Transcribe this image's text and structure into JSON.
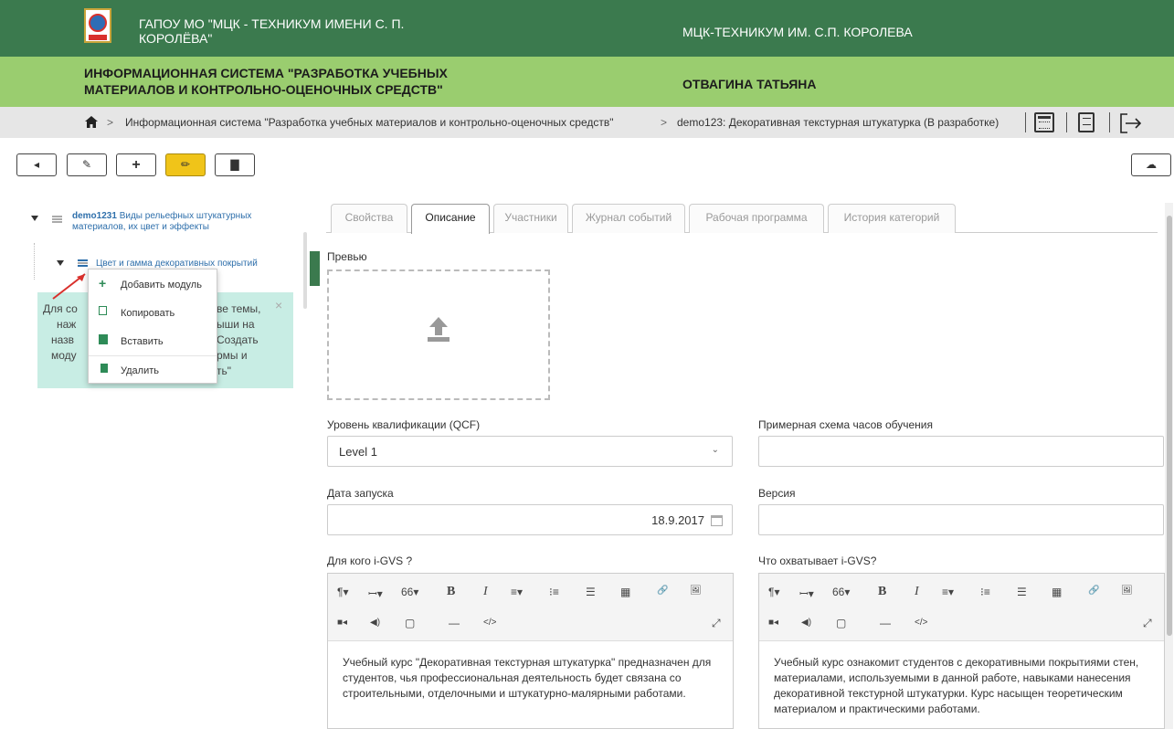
{
  "header": {
    "org_name": "ГАПОУ МО \"МЦК - ТЕХНИКУМ ИМЕНИ С. П. КОРОЛЁВА\"",
    "org_short": "МЦК-ТЕХНИКУМ ИМ. С.П. КОРОЛЕВА",
    "system_name": "ИНФОРМАЦИОННАЯ СИСТЕМА \"РАЗРАБОТКА УЧЕБНЫХ МАТЕРИАЛОВ И КОНТРОЛЬНО-ОЦЕНОЧНЫХ СРЕДСТВ\"",
    "user_name": "ОТВАГИНА ТАТЬЯНА",
    "colors": {
      "top": "#3b7a4e",
      "second": "#9acd6f"
    }
  },
  "breadcrumb": {
    "home_icon": "home-icon",
    "items": [
      "Информационная система \"Разработка учебных материалов и контрольно-оценочных средств\"",
      "demo123: Декоративная текстурная штукатурка (В разработке)"
    ],
    "separator": ">",
    "icons": [
      "calendar-icon",
      "document-icon",
      "logout-icon"
    ]
  },
  "toolbar": {
    "buttons": [
      {
        "name": "back",
        "icon": "caret-left-icon"
      },
      {
        "name": "edit",
        "icon": "edit-icon"
      },
      {
        "name": "add",
        "icon": "plus-icon"
      },
      {
        "name": "pencil",
        "icon": "pencil-icon"
      },
      {
        "name": "book",
        "icon": "book-icon"
      }
    ],
    "cloud_icon": "cloud-upload-icon",
    "accent": "#f0c419"
  },
  "tree": {
    "root": {
      "code": "demo1231",
      "title": "Виды рельефных штукатурных материалов, их цвет и эффекты"
    },
    "child": {
      "title": "Цвет и гамма декоративных покрытий"
    }
  },
  "hint": {
    "text_lines": [
      "Для со",
      "ве темы,",
      "наж",
      "ыши на",
      "назв",
      "Создать",
      "моду",
      "рмы и",
      "ть\""
    ]
  },
  "context_menu": {
    "items": [
      {
        "label": "Добавить модуль",
        "icon": "plus-icon"
      },
      {
        "label": "Копировать",
        "icon": "copy-icon"
      },
      {
        "label": "Вставить",
        "icon": "paste-icon"
      },
      {
        "label": "Удалить",
        "icon": "trash-icon"
      }
    ]
  },
  "tabs": [
    {
      "label": "Свойства",
      "active": false
    },
    {
      "label": "Описание",
      "active": true
    },
    {
      "label": "Участники",
      "active": false
    },
    {
      "label": "Журнал событий",
      "active": false
    },
    {
      "label": "Рабочая программа",
      "active": false
    },
    {
      "label": "История категорий",
      "active": false
    }
  ],
  "form": {
    "preview_label": "Превью",
    "qcf_label": "Уровень квалификации (QCF)",
    "qcf_value": "Level 1",
    "hours_label": "Примерная схема часов обучения",
    "hours_value": "",
    "launch_label": "Дата запуска",
    "launch_value": "18.9.2017",
    "version_label": "Версия",
    "version_value": "",
    "who_label": "Для кого i-GVS ?",
    "who_text": "Учебный курс \"Декоративная текстурная штукатурка\" предназначен для студентов, чья профессиональная деятельность будет связана со строительными, отделочными и штукатурно-малярными работами.",
    "covers_label": "Что охватывает i-GVS?",
    "covers_text": "Учебный курс ознакомит студентов с декоративными покрытиями стен, материалами, используемыми в данной работе, навыками нанесения декоративной текстурной штукатурки. Курс насыщен теоретическим материалом и практическими работами."
  },
  "editor_toolbar": {
    "row1": [
      "¶▾",
      "ꟷ▾",
      "66▾",
      "B",
      "I",
      "≡▾",
      "⁝≡",
      "☰",
      "▦",
      "🔗",
      "🖼"
    ],
    "row2": [
      "■◂",
      "◀)",
      "▢",
      "—",
      "</>"
    ]
  }
}
